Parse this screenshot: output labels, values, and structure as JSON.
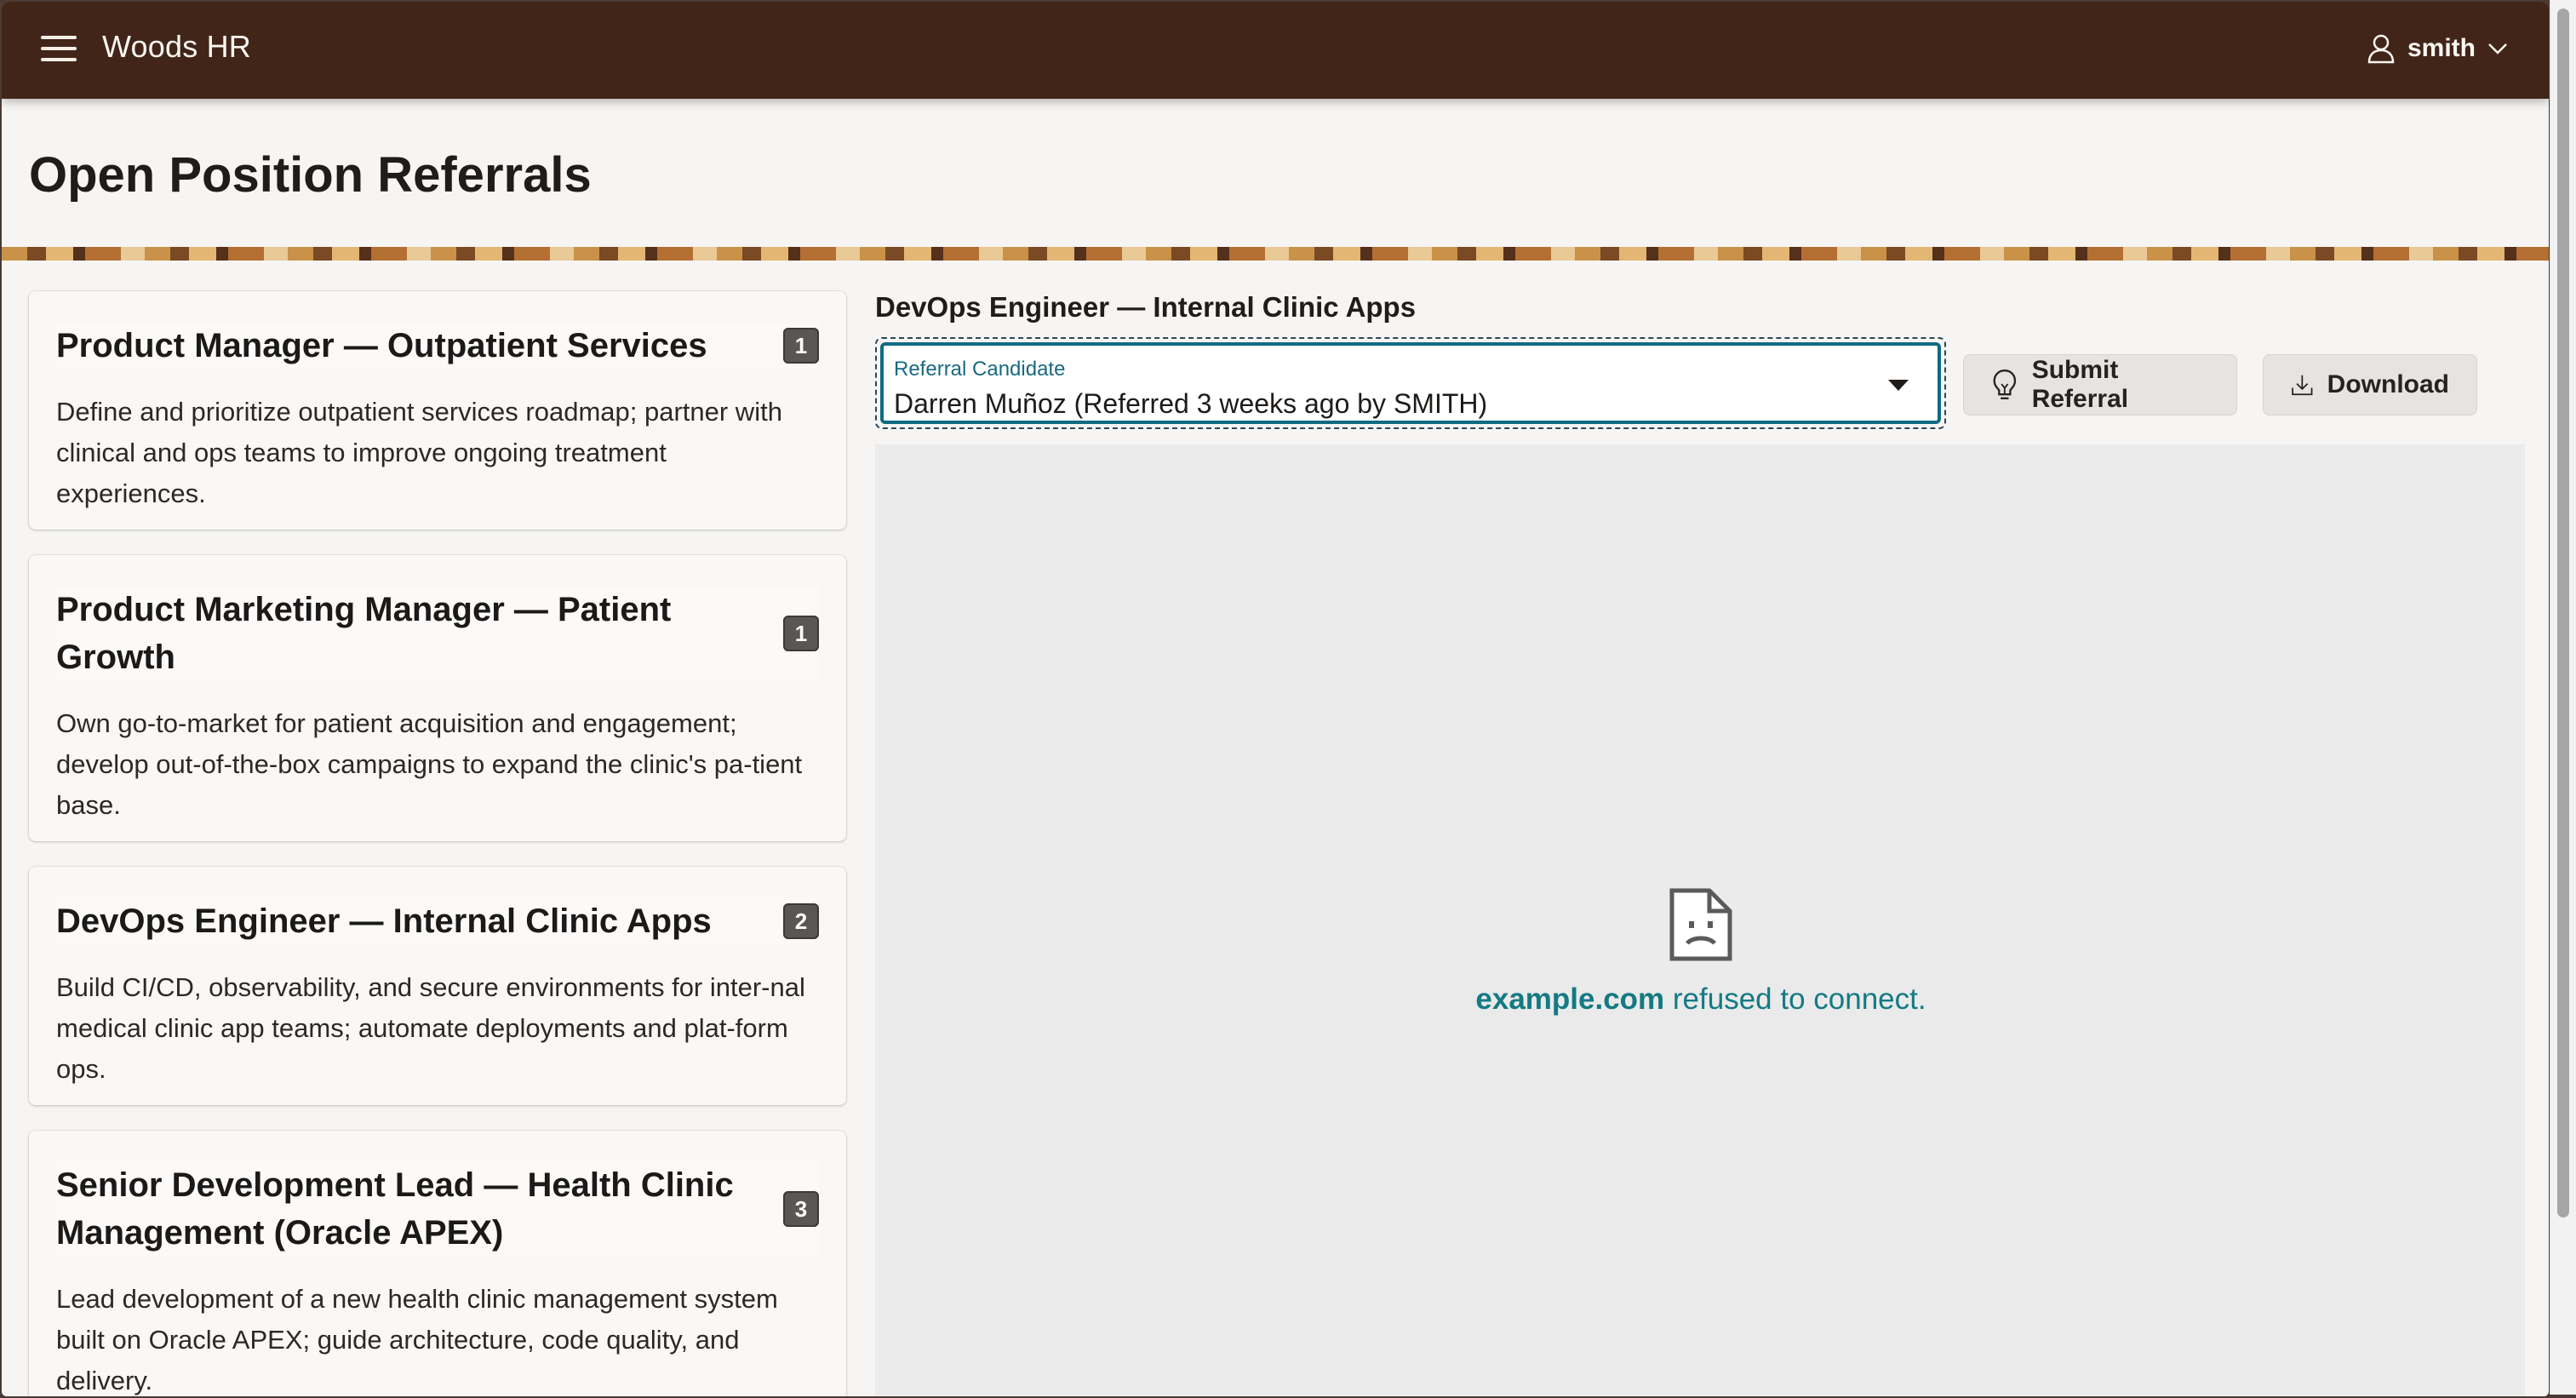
{
  "app": {
    "title": "Woods HR",
    "user": "smith"
  },
  "page": {
    "title": "Open Position Referrals"
  },
  "positions": [
    {
      "title": "Product Manager — Outpatient Services",
      "count": "1",
      "description": "Define and prioritize outpatient services roadmap; partner with clinical and ops teams to improve ongoing treatment experiences."
    },
    {
      "title": "Product Marketing Manager — Patient Growth",
      "count": "1",
      "description": "Own go-to-market for patient acquisition and engagement; develop out-of-the-box campaigns to expand the clinic's pa-tient base."
    },
    {
      "title": "DevOps Engineer — Internal Clinic Apps",
      "count": "2",
      "description": "Build CI/CD, observability, and secure environments for inter-nal medical clinic app teams; automate deployments and plat-form ops."
    },
    {
      "title": "Senior Development Lead — Health Clinic Management (Oracle APEX)",
      "count": "3",
      "description": "Lead development of a new health clinic management system built on Oracle APEX; guide architecture, code quality, and delivery."
    }
  ],
  "detail": {
    "title": "DevOps Engineer — Internal Clinic Apps",
    "referral_field": {
      "label": "Referral Candidate",
      "value": "Darren Muñoz (Referred 3 weeks ago by SMITH)"
    },
    "submit_label": "Submit Referral",
    "download_label": "Download",
    "frame_error": {
      "domain": "example.com",
      "message": "refused to connect."
    }
  },
  "icons": {
    "menu": "hamburger-icon",
    "user": "user-icon",
    "chevron": "chevron-down-icon",
    "submit": "lightbulb-icon",
    "download": "download-icon",
    "error": "sad-document-icon"
  },
  "colors": {
    "header": "#422519",
    "accent": "#0f6a82",
    "error_text": "#147a83",
    "badge": "#5a5653"
  }
}
